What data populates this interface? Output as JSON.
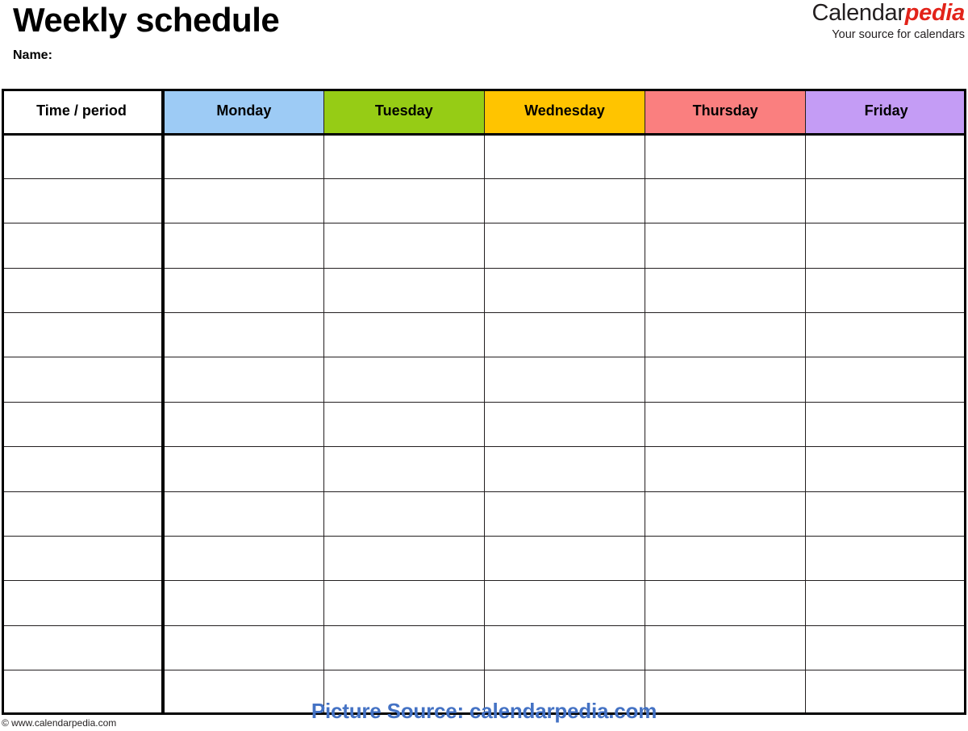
{
  "header": {
    "title": "Weekly schedule",
    "name_label": "Name:",
    "brand": {
      "word_first": "Calendar",
      "word_second": "pedia",
      "tagline": "Your source for calendars"
    }
  },
  "table": {
    "columns": [
      {
        "label": "Time / period",
        "color": "#ffffff",
        "key": "time"
      },
      {
        "label": "Monday",
        "color": "#9dcbf5",
        "key": "monday"
      },
      {
        "label": "Tuesday",
        "color": "#96cc15",
        "key": "tuesday"
      },
      {
        "label": "Wednesday",
        "color": "#ffc400",
        "key": "wednesday"
      },
      {
        "label": "Thursday",
        "color": "#fa7f7f",
        "key": "thursday"
      },
      {
        "label": "Friday",
        "color": "#c49cf5",
        "key": "friday"
      }
    ],
    "row_count": 13,
    "rows": [
      {
        "time": "",
        "monday": "",
        "tuesday": "",
        "wednesday": "",
        "thursday": "",
        "friday": ""
      },
      {
        "time": "",
        "monday": "",
        "tuesday": "",
        "wednesday": "",
        "thursday": "",
        "friday": ""
      },
      {
        "time": "",
        "monday": "",
        "tuesday": "",
        "wednesday": "",
        "thursday": "",
        "friday": ""
      },
      {
        "time": "",
        "monday": "",
        "tuesday": "",
        "wednesday": "",
        "thursday": "",
        "friday": ""
      },
      {
        "time": "",
        "monday": "",
        "tuesday": "",
        "wednesday": "",
        "thursday": "",
        "friday": ""
      },
      {
        "time": "",
        "monday": "",
        "tuesday": "",
        "wednesday": "",
        "thursday": "",
        "friday": ""
      },
      {
        "time": "",
        "monday": "",
        "tuesday": "",
        "wednesday": "",
        "thursday": "",
        "friday": ""
      },
      {
        "time": "",
        "monday": "",
        "tuesday": "",
        "wednesday": "",
        "thursday": "",
        "friday": ""
      },
      {
        "time": "",
        "monday": "",
        "tuesday": "",
        "wednesday": "",
        "thursday": "",
        "friday": ""
      },
      {
        "time": "",
        "monday": "",
        "tuesday": "",
        "wednesday": "",
        "thursday": "",
        "friday": ""
      },
      {
        "time": "",
        "monday": "",
        "tuesday": "",
        "wednesday": "",
        "thursday": "",
        "friday": ""
      },
      {
        "time": "",
        "monday": "",
        "tuesday": "",
        "wednesday": "",
        "thursday": "",
        "friday": ""
      },
      {
        "time": "",
        "monday": "",
        "tuesday": "",
        "wednesday": "",
        "thursday": "",
        "friday": ""
      }
    ]
  },
  "footer": {
    "copyright": "© www.calendarpedia.com",
    "watermark": "Picture Source: calendarpedia.com",
    "watermark_color": "#4472c4"
  }
}
